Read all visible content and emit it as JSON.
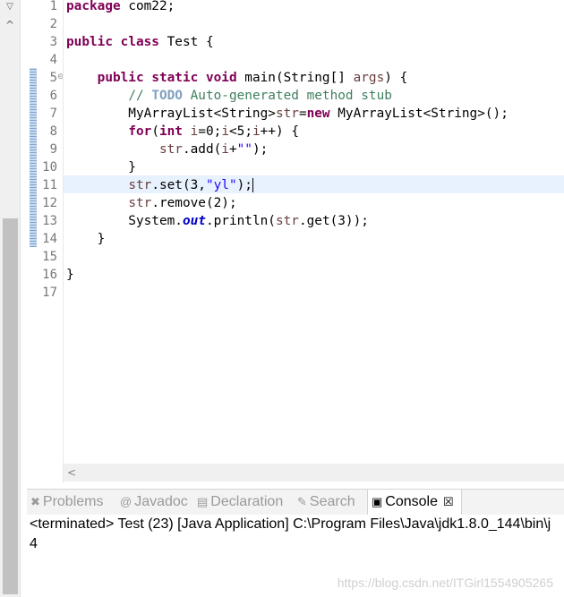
{
  "scrollbar": {
    "top_glyph": "▽",
    "up_glyph": "^"
  },
  "editor": {
    "line_numbers": [
      "1",
      "2",
      "3",
      "4",
      "5",
      "6",
      "7",
      "8",
      "9",
      "10",
      "11",
      "12",
      "13",
      "14",
      "15",
      "16",
      "17"
    ],
    "fold_glyph": "⊖",
    "lines": [
      {
        "parts": [
          {
            "t": "package",
            "c": "kw"
          },
          {
            "t": " com22;"
          }
        ]
      },
      {
        "parts": []
      },
      {
        "parts": [
          {
            "t": "public",
            "c": "kw"
          },
          {
            "t": " "
          },
          {
            "t": "class",
            "c": "kw"
          },
          {
            "t": " Test {"
          }
        ]
      },
      {
        "parts": []
      },
      {
        "parts": [
          {
            "t": "    "
          },
          {
            "t": "public",
            "c": "kw"
          },
          {
            "t": " "
          },
          {
            "t": "static",
            "c": "kw"
          },
          {
            "t": " "
          },
          {
            "t": "void",
            "c": "kw"
          },
          {
            "t": " main(String[] "
          },
          {
            "t": "args",
            "c": "var"
          },
          {
            "t": ") {"
          }
        ]
      },
      {
        "parts": [
          {
            "t": "        "
          },
          {
            "t": "// ",
            "c": "cm"
          },
          {
            "t": "TODO",
            "c": "todo"
          },
          {
            "t": " Auto-generated method stub",
            "c": "cm"
          }
        ]
      },
      {
        "parts": [
          {
            "t": "        MyArrayList<String>"
          },
          {
            "t": "str",
            "c": "var"
          },
          {
            "t": "="
          },
          {
            "t": "new",
            "c": "kw"
          },
          {
            "t": " MyArrayList<String>();"
          }
        ]
      },
      {
        "parts": [
          {
            "t": "        "
          },
          {
            "t": "for",
            "c": "kw"
          },
          {
            "t": "("
          },
          {
            "t": "int",
            "c": "kw"
          },
          {
            "t": " "
          },
          {
            "t": "i",
            "c": "var"
          },
          {
            "t": "=0;"
          },
          {
            "t": "i",
            "c": "var"
          },
          {
            "t": "<5;"
          },
          {
            "t": "i",
            "c": "var"
          },
          {
            "t": "++) {"
          }
        ]
      },
      {
        "parts": [
          {
            "t": "            "
          },
          {
            "t": "str",
            "c": "var"
          },
          {
            "t": ".add("
          },
          {
            "t": "i",
            "c": "var"
          },
          {
            "t": "+"
          },
          {
            "t": "\"\"",
            "c": "str"
          },
          {
            "t": ");"
          }
        ]
      },
      {
        "parts": [
          {
            "t": "        }"
          }
        ]
      },
      {
        "parts": [
          {
            "t": "        "
          },
          {
            "t": "str",
            "c": "var"
          },
          {
            "t": ".set(3,"
          },
          {
            "t": "\"yl\"",
            "c": "str"
          },
          {
            "t": ");"
          },
          {
            "t": "",
            "c": "caret"
          }
        ]
      },
      {
        "parts": [
          {
            "t": "        "
          },
          {
            "t": "str",
            "c": "var"
          },
          {
            "t": ".remove(2);"
          }
        ]
      },
      {
        "parts": [
          {
            "t": "        System."
          },
          {
            "t": "out",
            "c": "static-it"
          },
          {
            "t": ".println("
          },
          {
            "t": "str",
            "c": "var"
          },
          {
            "t": ".get(3));"
          }
        ]
      },
      {
        "parts": [
          {
            "t": "    }"
          }
        ]
      },
      {
        "parts": []
      },
      {
        "parts": [
          {
            "t": "}"
          }
        ]
      },
      {
        "parts": []
      }
    ],
    "hscroll_glyph": "<"
  },
  "console_view": {
    "tabs": [
      {
        "label": "Problems",
        "icon": "problems-icon",
        "glyph": "✖",
        "active": false
      },
      {
        "label": "Javadoc",
        "icon": "javadoc-icon",
        "glyph": "@",
        "active": false
      },
      {
        "label": "Declaration",
        "icon": "declaration-icon",
        "glyph": "▤",
        "active": false
      },
      {
        "label": "Search",
        "icon": "search-icon",
        "glyph": "✎",
        "active": false
      },
      {
        "label": "Console",
        "icon": "console-icon",
        "glyph": "▣",
        "active": true
      }
    ],
    "close_glyph": "☒",
    "status": "<terminated> Test (23) [Java Application] C:\\Program Files\\Java\\jdk1.8.0_144\\bin\\j",
    "output": "4",
    "watermark": "https://blog.csdn.net/ITGirl1554905265"
  },
  "colors": {
    "keyword": "#7f0055",
    "string": "#2a00ff",
    "comment": "#3f7f5f",
    "current_line": "#e8f2fe"
  }
}
